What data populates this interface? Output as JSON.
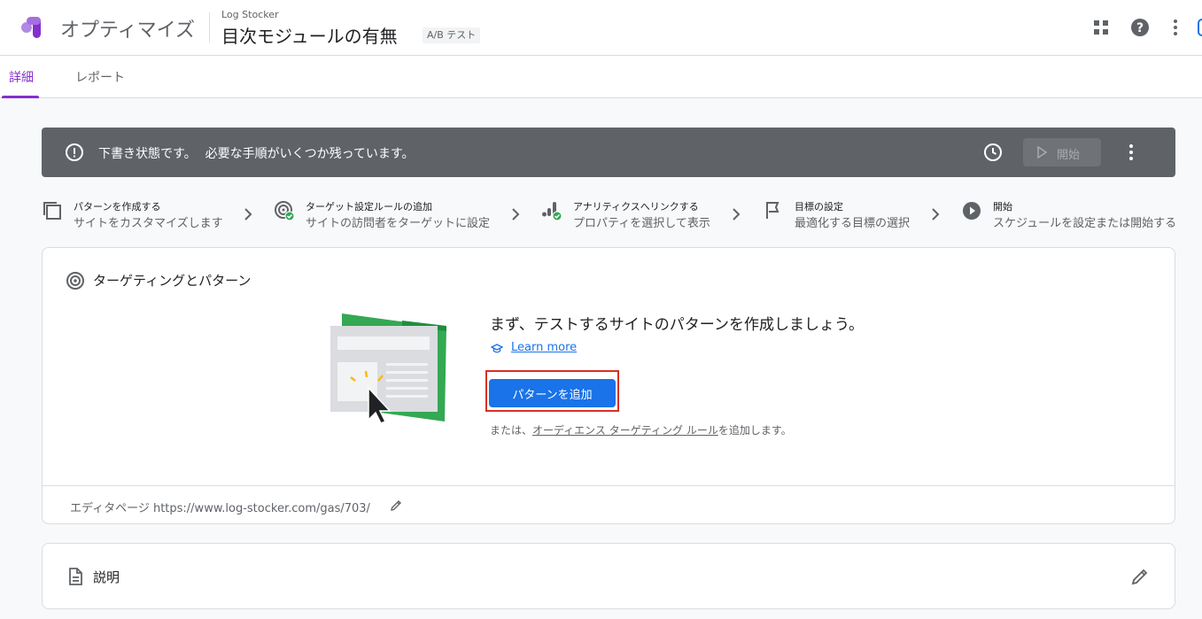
{
  "header": {
    "product_name": "オプティマイズ",
    "container_name": "Log Stocker",
    "experiment_title": "目次モジュールの有無",
    "type_badge": "A/B テスト",
    "icons": [
      "optimize-logo-icon",
      "apps-grid-icon",
      "help-icon",
      "more-vert-icon"
    ]
  },
  "tabs": [
    {
      "label": "詳細",
      "active": true
    },
    {
      "label": "レポート",
      "active": false
    }
  ],
  "banner": {
    "status": "下書き状態です。",
    "message": "必要な手順がいくつか残っています。",
    "start_label": "開始",
    "start_enabled": false
  },
  "steps": [
    {
      "title": "パターンを作成する",
      "desc": "サイトをカスタマイズします",
      "icon": "copy-variant-icon",
      "done": false
    },
    {
      "title": "ターゲット設定ルールの追加",
      "desc": "サイトの訪問者をターゲットに設定",
      "icon": "target-check-icon",
      "done": true
    },
    {
      "title": "アナリティクスへリンクする",
      "desc": "プロパティを選択して表示",
      "icon": "analytics-check-icon",
      "done": true
    },
    {
      "title": "目標の設定",
      "desc": "最適化する目標の選択",
      "icon": "flag-icon",
      "done": false
    },
    {
      "title": "開始",
      "desc": "スケジュールを設定または開始する",
      "icon": "play-circle-icon",
      "done": false
    }
  ],
  "targeting_card": {
    "title": "ターゲティングとパターン",
    "heading": "まず、テストするサイトのパターンを作成しましょう。",
    "learn_more": "Learn more",
    "add_variant_label": "パターンを追加",
    "alt_prefix": "または、",
    "alt_link": "オーディエンス ターゲティング ルール",
    "alt_suffix": "を追加します。",
    "editor_label": "エディタページ https://www.log-stocker.com/gas/703/"
  },
  "description_card": {
    "title": "説明"
  },
  "colors": {
    "accent_purple": "#8430ce",
    "primary_blue": "#1a73e8",
    "banner_gray": "#5f6368",
    "highlight_red": "#d93025",
    "success_green": "#34a853"
  }
}
